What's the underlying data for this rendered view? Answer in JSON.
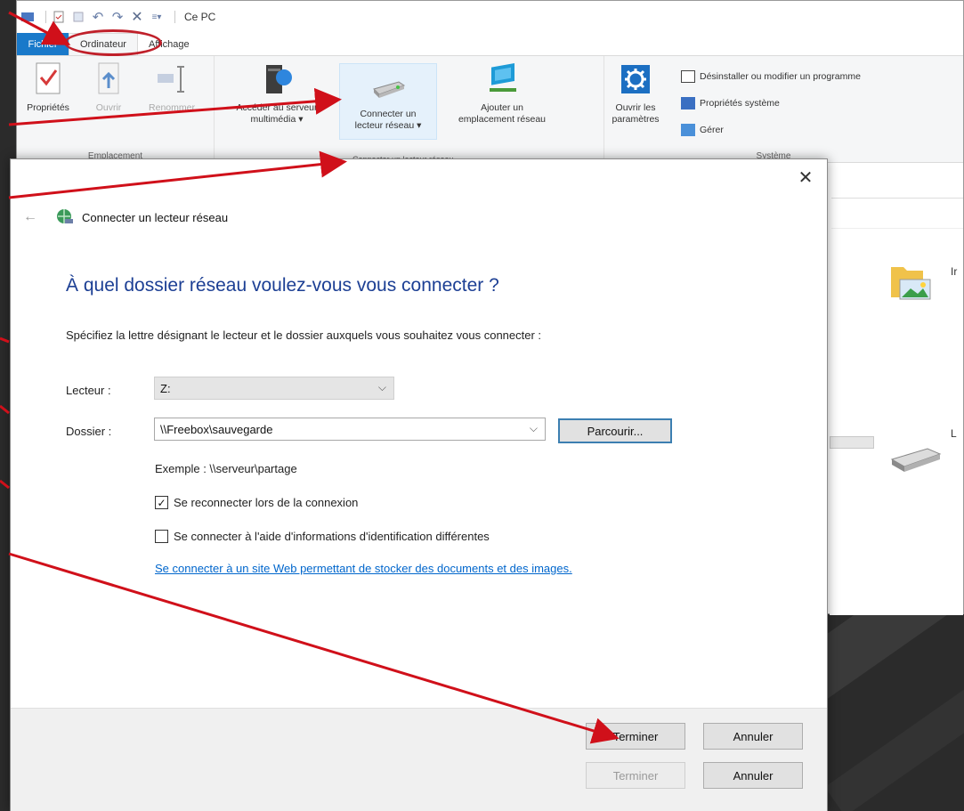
{
  "explorer": {
    "title": "Ce PC",
    "tabs": [
      {
        "label": "Fichier"
      },
      {
        "label": "Ordinateur"
      },
      {
        "label": "Affichage"
      }
    ],
    "location_group": {
      "label": "Emplacement",
      "buttons": [
        "Propriétés",
        "Ouvrir",
        "Renommer"
      ]
    },
    "network_group": {
      "buttons": [
        {
          "line1": "Accéder au serveur",
          "line2": "multimédia ▾"
        },
        {
          "line1": "Connecter un",
          "line2": "lecteur réseau ▾"
        },
        {
          "line1": "Ajouter un",
          "line2": "emplacement réseau"
        }
      ],
      "dropdown_item": "Connecter un lecteur réseau"
    },
    "system_group": {
      "label": "Système",
      "settings_line1": "Ouvrir les",
      "settings_line2": "paramètres",
      "commands": [
        "Désinstaller ou modifier un programme",
        "Propriétés système",
        "Gérer"
      ]
    },
    "right_partial": [
      "Ir",
      "L"
    ]
  },
  "dialog": {
    "caption": "Connecter un lecteur réseau",
    "heading": "À quel dossier réseau voulez-vous vous connecter ?",
    "instruction": "Spécifiez la lettre désignant le lecteur et le dossier auxquels vous souhaitez vous connecter :",
    "drive_label": "Lecteur :",
    "drive_value": "Z:",
    "folder_label": "Dossier :",
    "folder_value": "\\\\Freebox\\sauvegarde",
    "browse_label": "Parcourir...",
    "example": "Exemple : \\\\serveur\\partage",
    "reconnect_label": "Se reconnecter lors de la connexion",
    "reconnect_checked": true,
    "other_credentials_label": "Se connecter à l'aide d'informations d'identification différentes",
    "other_credentials_checked": false,
    "web_link": "Se connecter à un site Web permettant de stocker des documents et des images.",
    "finish_label": "Terminer",
    "cancel_label": "Annuler"
  },
  "behind_footer": {
    "finish_label": "Terminer",
    "cancel_label": "Annuler"
  },
  "colors": {
    "accent_blue": "#1979ca",
    "heading_blue": "#1c3f94",
    "annotation_red": "#d0101a",
    "link_blue": "#0066cc"
  },
  "icons": [
    "properties-icon",
    "open-icon",
    "rename-icon",
    "media-server-icon",
    "network-drive-icon",
    "network-location-icon",
    "settings-gear-icon",
    "uninstall-icon",
    "system-properties-icon",
    "manage-icon",
    "network-globe-icon",
    "back-arrow-icon",
    "close-icon",
    "chevron-down-icon"
  ]
}
